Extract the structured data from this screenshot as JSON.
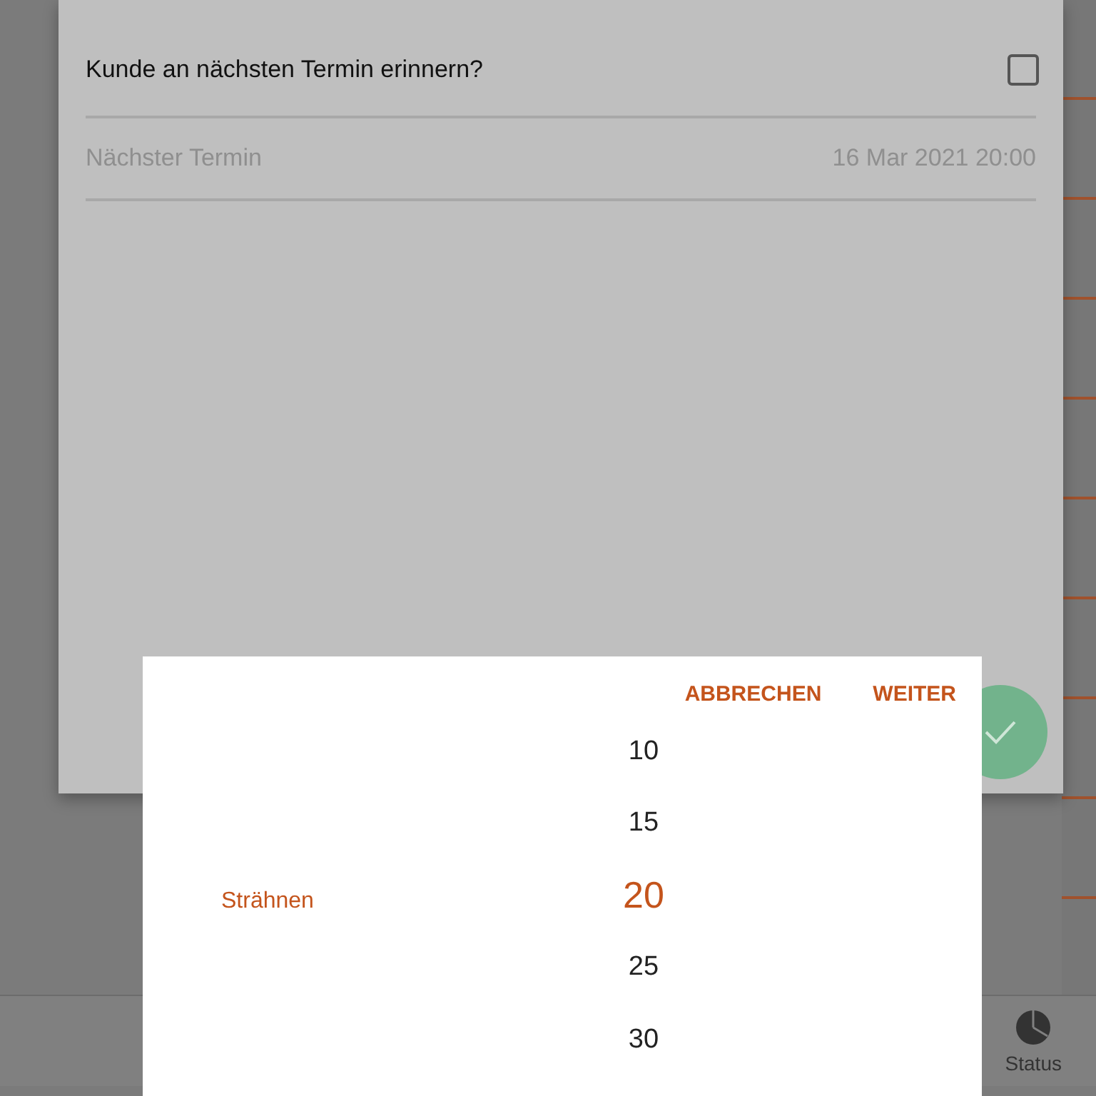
{
  "dialog": {
    "reminder": {
      "label": "Kunde an nächsten Termin erinnern?",
      "checked": false
    },
    "next_appointment": {
      "label": "Nächster Termin",
      "value": "16 Mar 2021 20:00"
    }
  },
  "bottom_nav": {
    "items": [
      {
        "label": "Status"
      }
    ]
  },
  "picker": {
    "actions": [
      "ABBRECHEN",
      "WEITER"
    ],
    "label": "Strähnen",
    "options": [
      {
        "value": "10",
        "selected": false
      },
      {
        "value": "15",
        "selected": false
      },
      {
        "value": "20",
        "selected": true
      },
      {
        "value": "25",
        "selected": false
      },
      {
        "value": "30",
        "selected": false
      }
    ]
  }
}
